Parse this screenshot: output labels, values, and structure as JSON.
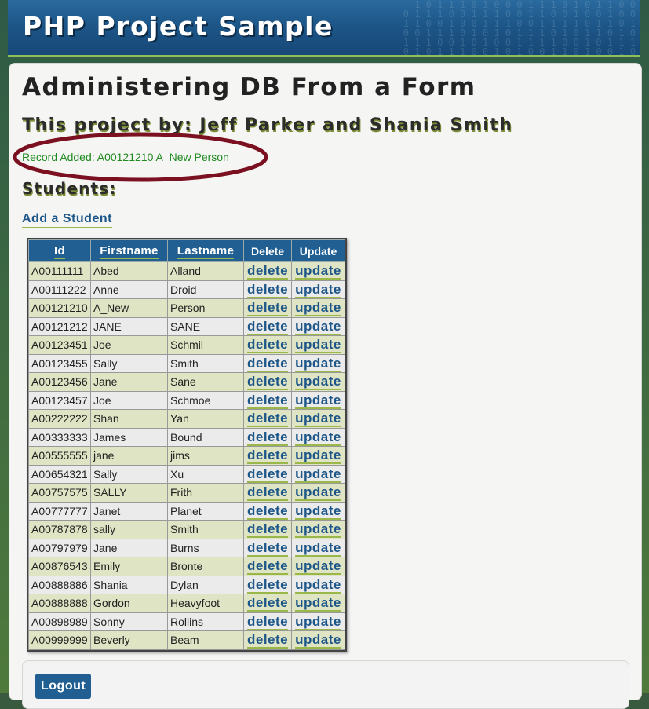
{
  "header": {
    "title": "PHP Project Sample"
  },
  "page": {
    "heading": "Administering DB From a Form",
    "subheading": "This project by: Jeff Parker and Shania Smith",
    "status_message": "Record Added: A00121210 A_New Person",
    "section_title": "Students:",
    "add_link": "Add a Student"
  },
  "table": {
    "headers": {
      "id": "Id",
      "firstname": "Firstname",
      "lastname": "Lastname",
      "delete": "Delete",
      "update": "Update"
    },
    "delete_label": "delete",
    "update_label": "update",
    "rows": [
      {
        "id": "A00111111",
        "firstname": "Abed",
        "lastname": "Alland"
      },
      {
        "id": "A00111222",
        "firstname": "Anne",
        "lastname": "Droid"
      },
      {
        "id": "A00121210",
        "firstname": "A_New",
        "lastname": "Person"
      },
      {
        "id": "A00121212",
        "firstname": "JANE",
        "lastname": "SANE"
      },
      {
        "id": "A00123451",
        "firstname": "Joe",
        "lastname": "Schmil"
      },
      {
        "id": "A00123455",
        "firstname": "Sally",
        "lastname": "Smith"
      },
      {
        "id": "A00123456",
        "firstname": "Jane",
        "lastname": "Sane"
      },
      {
        "id": "A00123457",
        "firstname": "Joe",
        "lastname": "Schmoe"
      },
      {
        "id": "A00222222",
        "firstname": "Shan",
        "lastname": "Yan"
      },
      {
        "id": "A00333333",
        "firstname": "James",
        "lastname": "Bound"
      },
      {
        "id": "A00555555",
        "firstname": "jane",
        "lastname": "jims"
      },
      {
        "id": "A00654321",
        "firstname": "Sally",
        "lastname": "Xu"
      },
      {
        "id": "A00757575",
        "firstname": "SALLY",
        "lastname": "Frith"
      },
      {
        "id": "A00777777",
        "firstname": "Janet",
        "lastname": "Planet"
      },
      {
        "id": "A00787878",
        "firstname": "sally",
        "lastname": "Smith"
      },
      {
        "id": "A00797979",
        "firstname": "Jane",
        "lastname": "Burns"
      },
      {
        "id": "A00876543",
        "firstname": "Emily",
        "lastname": "Bronte"
      },
      {
        "id": "A00888886",
        "firstname": "Shania",
        "lastname": "Dylan"
      },
      {
        "id": "A00888888",
        "firstname": "Gordon",
        "lastname": "Heavyfoot"
      },
      {
        "id": "A00898989",
        "firstname": "Sonny",
        "lastname": "Rollins"
      },
      {
        "id": "A00999999",
        "firstname": "Beverly",
        "lastname": "Beam"
      }
    ]
  },
  "footer": {
    "logout_label": "Logout"
  },
  "colors": {
    "header_blue": "#1d5688",
    "link_blue": "#1d5688",
    "status_green": "#1f8a1f",
    "annotation_ellipse": "#7a1020",
    "row_odd": "#dfe5c4",
    "row_even": "#ebebeb"
  }
}
